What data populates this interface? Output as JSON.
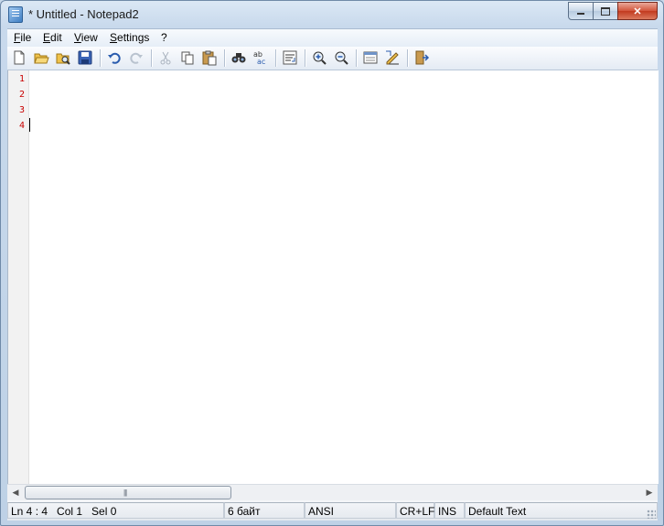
{
  "window": {
    "title": "* Untitled - Notepad2",
    "app_icon": "notepad-icon",
    "controls": {
      "minimize": "minimize-icon",
      "maximize": "maximize-icon",
      "close": "close-icon"
    }
  },
  "menu": [
    "File",
    "Edit",
    "View",
    "Settings",
    "?"
  ],
  "toolbar": {
    "icons": [
      "new-icon",
      "open-icon",
      "browse-icon",
      "save-icon",
      "undo-icon",
      "redo-icon",
      "cut-icon",
      "copy-icon",
      "paste-icon",
      "find-icon",
      "replace-icon",
      "word-wrap-icon",
      "zoom-in-icon",
      "zoom-out-icon",
      "scheme-icon",
      "customize-icon",
      "exit-icon"
    ],
    "disabled": [
      "redo-icon",
      "cut-icon"
    ]
  },
  "editor": {
    "line_numbers": [
      "1",
      "2",
      "3",
      "4"
    ],
    "line_number_color": "#c80000"
  },
  "status": {
    "position": "Ln 4 : 4   Col 1   Sel 0",
    "size": "6 байт",
    "encoding": "ANSI",
    "line_endings": "CR+LF",
    "mode": "INS",
    "scheme": "Default Text"
  },
  "colors": {
    "accent": "#3f7fc4",
    "close_button": "#c23a1f"
  }
}
